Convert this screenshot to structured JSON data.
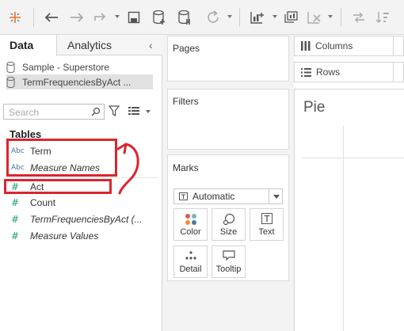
{
  "toolbar": {
    "icons": [
      "tableau-logo-icon",
      "undo-icon",
      "redo-icon",
      "replay-icon",
      "save-icon",
      "new-datasource-icon",
      "pause-updates-icon",
      "refresh-icon",
      "new-worksheet-icon",
      "duplicate-icon",
      "clear-icon",
      "swap-icon",
      "sort-icon"
    ]
  },
  "data_pane": {
    "tabs": {
      "data": "Data",
      "analytics": "Analytics"
    },
    "datasources": [
      {
        "label": "Sample - Superstore",
        "selected": false
      },
      {
        "label": "TermFrequenciesByAct ...",
        "selected": true
      }
    ],
    "search_placeholder": "Search",
    "section_title": "Tables",
    "fields": [
      {
        "icon": "Abc",
        "label": "Term",
        "italic": false
      },
      {
        "icon": "Abc",
        "label": "Measure Names",
        "italic": true
      },
      {
        "icon": "#",
        "label": "Act",
        "italic": false
      },
      {
        "icon": "#",
        "label": "Count",
        "italic": false
      },
      {
        "icon": "#",
        "label": "TermFrequenciesByAct (...",
        "italic": true
      },
      {
        "icon": "#",
        "label": "Measure Values",
        "italic": true
      }
    ],
    "annotation_color": "#d9262e"
  },
  "cards": {
    "pages": "Pages",
    "filters": "Filters",
    "marks": {
      "title": "Marks",
      "mark_type": "Automatic",
      "buttons": {
        "color": "Color",
        "size": "Size",
        "text": "Text",
        "detail": "Detail",
        "tooltip": "Tooltip"
      }
    }
  },
  "shelves": {
    "columns": "Columns",
    "rows": "Rows"
  },
  "view": {
    "title": "Pie"
  }
}
